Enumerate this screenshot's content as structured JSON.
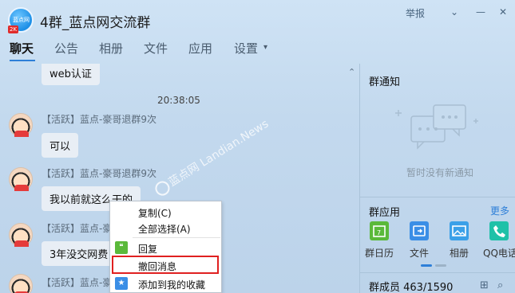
{
  "window": {
    "title": "4群_蓝点网交流群",
    "logo_text": "蓝点网",
    "logo_badge": "2K",
    "report": "举报",
    "minimize": "—",
    "close": "✕"
  },
  "tabs": [
    {
      "label": "聊天"
    },
    {
      "label": "公告"
    },
    {
      "label": "相册"
    },
    {
      "label": "文件"
    },
    {
      "label": "应用"
    },
    {
      "label": "设置"
    }
  ],
  "tab_dropdown": "▾",
  "chat": {
    "collapse": "⌃",
    "messages": [
      {
        "text": "web认证"
      },
      {
        "timestamp": "20:38:05"
      },
      {
        "sender": "【活跃】蓝点-豪哥退群9次",
        "text": "可以"
      },
      {
        "sender": "【活跃】蓝点-豪哥退群9次",
        "text": "我以前就这么干的"
      },
      {
        "sender": "【活跃】蓝点-豪",
        "text": "3年没交网费"
      },
      {
        "sender": "【活跃】蓝点-豪"
      }
    ]
  },
  "context_menu": {
    "items": [
      {
        "label": "复制(C)"
      },
      {
        "label": "全部选择(A)"
      },
      {
        "label": "回复",
        "icon": "quote-icon"
      },
      {
        "label": "撤回消息"
      },
      {
        "label": "添加到我的收藏",
        "icon": "star-icon"
      }
    ]
  },
  "watermark": {
    "text": "蓝点网 Landian.News"
  },
  "right_panel": {
    "notice_title": "群通知",
    "notice_empty": "暂时没有新通知",
    "apps_title": "群应用",
    "apps_more": "更多",
    "apps": [
      {
        "label": "群日历",
        "icon": "calendar-icon",
        "color": "#5ab93a"
      },
      {
        "label": "文件",
        "icon": "file-icon",
        "color": "#3a8ee6"
      },
      {
        "label": "相册",
        "icon": "photo-icon",
        "color": "#3aa0e8"
      },
      {
        "label": "QQ电话",
        "icon": "phone-icon",
        "color": "#1fc1a8"
      }
    ],
    "members_label": "群成员 463/1590"
  },
  "colors": {
    "accent": "#2d7fd8",
    "highlight_border": "#e02020"
  }
}
